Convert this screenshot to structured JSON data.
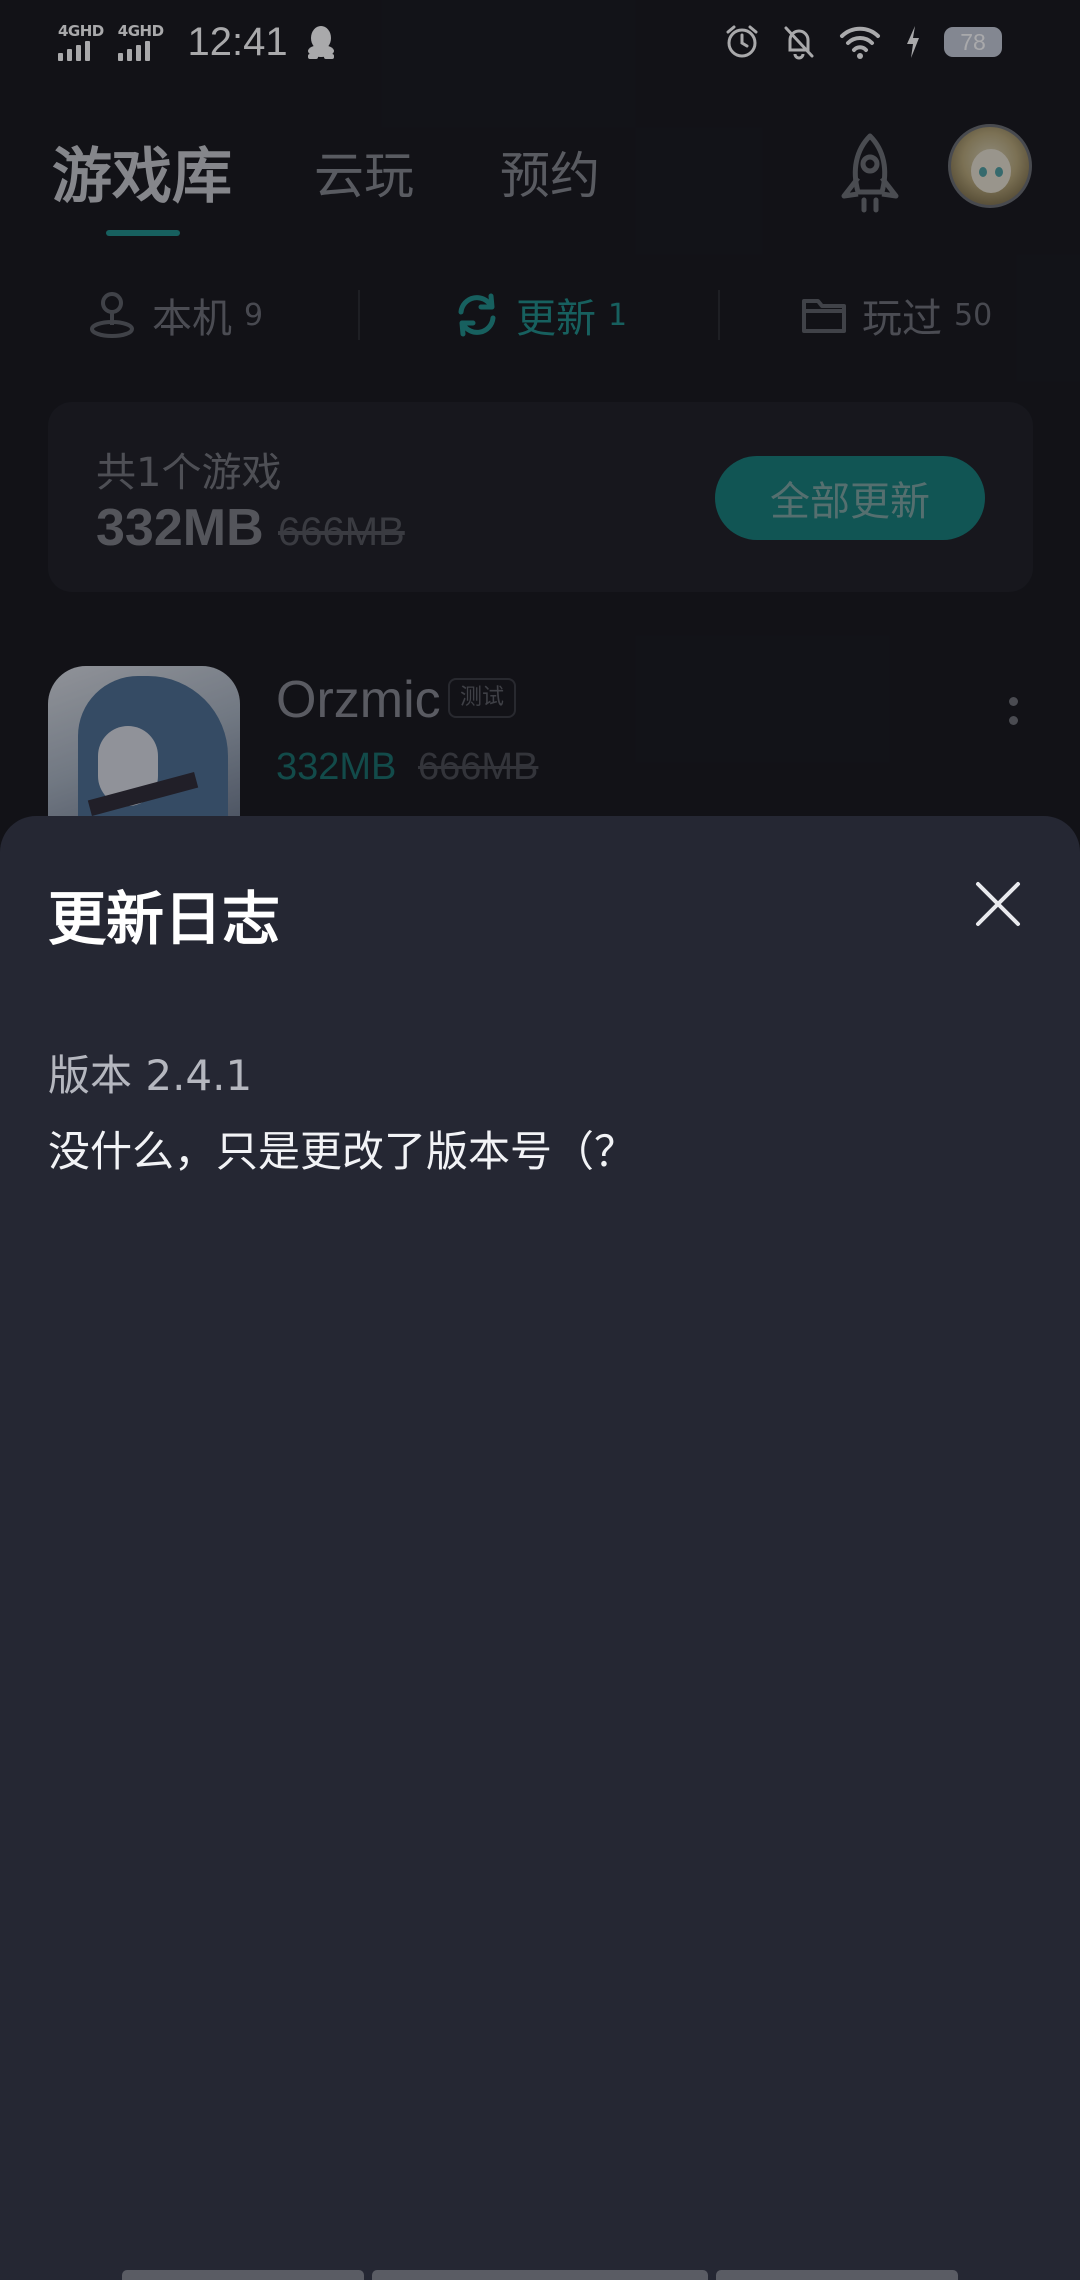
{
  "status_bar": {
    "sim1_label": "4GHD",
    "sim2_label": "4GHD",
    "time": "12:41",
    "battery": "78"
  },
  "header": {
    "tabs": [
      {
        "label": "游戏库",
        "active": true
      },
      {
        "label": "云玩",
        "active": false
      },
      {
        "label": "预约",
        "active": false
      }
    ],
    "rocket_icon": "rocket-icon",
    "avatar_icon": "avatar"
  },
  "subtabs": [
    {
      "label": "本机",
      "count": "9",
      "icon": "joystick-icon",
      "active": false
    },
    {
      "label": "更新",
      "count": "1",
      "icon": "refresh-icon",
      "active": true
    },
    {
      "label": "玩过",
      "count": "50",
      "icon": "folder-icon",
      "active": false
    }
  ],
  "summary": {
    "label": "共1个游戏",
    "size": "332MB",
    "original_size": "666MB",
    "update_all_label": "全部更新"
  },
  "game": {
    "name": "Orzmic",
    "tag": "测试",
    "size": "332MB",
    "original_size": "666MB"
  },
  "sheet": {
    "title": "更新日志",
    "version": "版本 2.4.1",
    "changelog": "没什么，只是更改了版本号（？"
  },
  "colors": {
    "accent": "#1f8f8a",
    "sheet_bg": "#252733",
    "page_bg": "#17181d"
  }
}
